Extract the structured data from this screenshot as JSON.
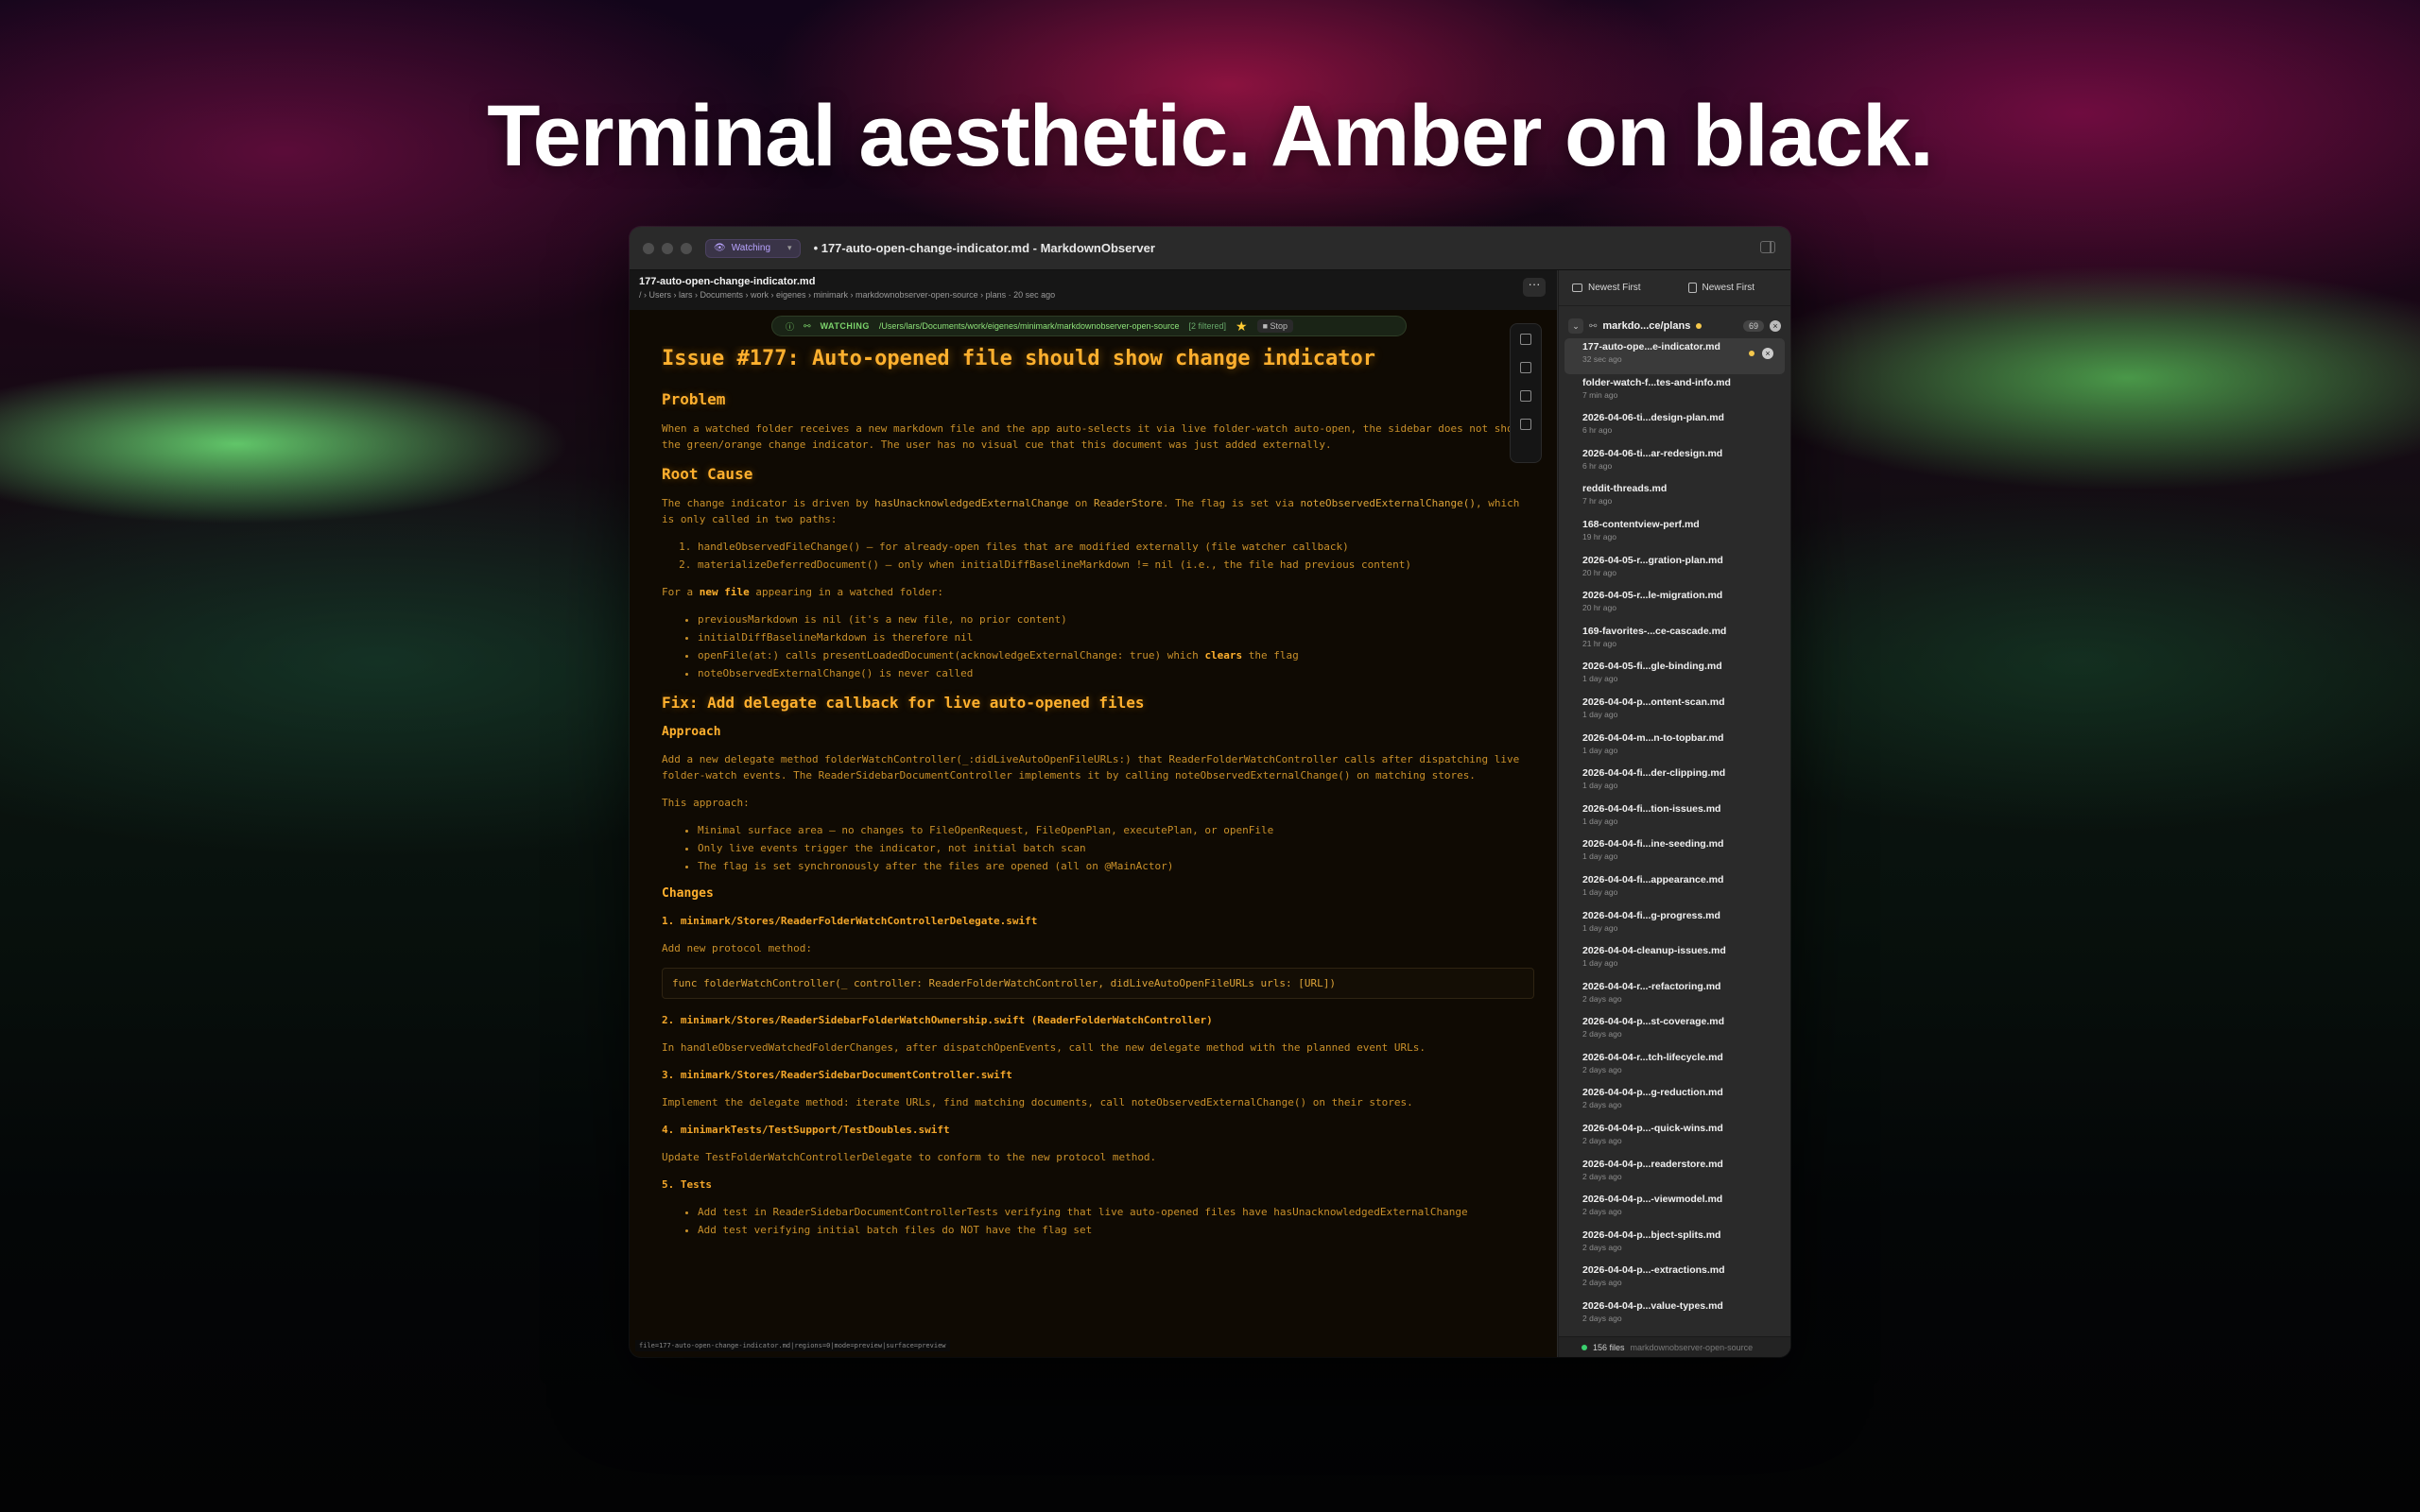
{
  "headline": "Terminal aesthetic. Amber on black.",
  "window": {
    "title": "• 177-auto-open-change-indicator.md - MarkdownObserver",
    "watch_pill": "Watching"
  },
  "doc_header": {
    "filename": "177-auto-open-change-indicator.md",
    "path": "/ › Users › lars › Documents › work › eigenes › minimark › markdownobserver-open-source › plans · 20 sec ago",
    "more": "···"
  },
  "watch_bar": {
    "label": "WATCHING",
    "path": "/Users/lars/Documents/work/eigenes/minimark/markdownobserver-open-source",
    "filtered": "[2 filtered]",
    "stop": "■ Stop"
  },
  "doc": {
    "h1": "Issue #177: Auto-opened file should show change indicator",
    "problem_h": "Problem",
    "problem_p": "When a watched folder receives a new markdown file and the app auto-selects it via live folder-watch auto-open, the sidebar does not show the green/orange change indicator. The user has no visual cue that this document was just added externally.",
    "root_h": "Root Cause",
    "root_p1a": "The change indicator is driven by ",
    "root_p1b": "hasUnacknowledgedExternalChange",
    "root_p1c": " on ",
    "root_p1d": "ReaderStore",
    "root_p1e": ". The flag is set via ",
    "root_p1f": "noteObservedExternalChange()",
    "root_p1g": ", which is only called in two paths:",
    "root_ol1": "handleObservedFileChange() — for already-open files that are modified externally (file watcher callback)",
    "root_ol2": "materializeDeferredDocument() — only when initialDiffBaselineMarkdown != nil (i.e., the file had previous content)",
    "root_p2a": "For a ",
    "root_p2b": "new file",
    "root_p2c": " appearing in a watched folder:",
    "root_ul1": "previousMarkdown is nil (it's a new file, no prior content)",
    "root_ul2": "initialDiffBaselineMarkdown is therefore nil",
    "root_ul3a": "openFile(at:) calls presentLoadedDocument(acknowledgeExternalChange: true) which ",
    "root_ul3b": "clears",
    "root_ul3c": " the flag",
    "root_ul4": "noteObservedExternalChange() is never called",
    "fix_h": "Fix: Add delegate callback for live auto-opened files",
    "approach_h": "Approach",
    "approach_p": "Add a new delegate method folderWatchController(_:didLiveAutoOpenFileURLs:) that ReaderFolderWatchController calls after dispatching live folder-watch events. The ReaderSidebarDocumentController implements it by calling noteObservedExternalChange() on matching stores.",
    "approach_p2": "This approach:",
    "approach_ul1": "Minimal surface area — no changes to FileOpenRequest, FileOpenPlan, executePlan, or openFile",
    "approach_ul2": "Only live events trigger the indicator, not initial batch scan",
    "approach_ul3": "The flag is set synchronously after the files are opened (all on @MainActor)",
    "changes_h": "Changes",
    "c1_h": "1. minimark/Stores/ReaderFolderWatchControllerDelegate.swift",
    "c1_p": "Add new protocol method:",
    "c1_code": "func folderWatchController(_ controller: ReaderFolderWatchController, didLiveAutoOpenFileURLs urls: [URL])",
    "c2_h": "2. minimark/Stores/ReaderSidebarFolderWatchOwnership.swift (ReaderFolderWatchController)",
    "c2_p": "In handleObservedWatchedFolderChanges, after dispatchOpenEvents, call the new delegate method with the planned event URLs.",
    "c3_h": "3. minimark/Stores/ReaderSidebarDocumentController.swift",
    "c3_p": "Implement the delegate method: iterate URLs, find matching documents, call noteObservedExternalChange() on their stores.",
    "c4_h": "4. minimarkTests/TestSupport/TestDoubles.swift",
    "c4_p": "Update TestFolderWatchControllerDelegate to conform to the new protocol method.",
    "c5_h": "5. Tests",
    "c5_ul1": "Add test in ReaderSidebarDocumentControllerTests verifying that live auto-opened files have hasUnacknowledgedExternalChange",
    "c5_ul2": "Add test verifying initial batch files do NOT have the flag set"
  },
  "status_strip": "file=177-auto-open-change-indicator.md|regions=0|mode=preview|surface=preview",
  "sidebar": {
    "sort_left": "Newest First",
    "sort_right": "Newest First",
    "folder_name": "markdo...ce/plans",
    "folder_count": "69",
    "files": [
      {
        "name": "177-auto-ope...e-indicator.md",
        "time": "32 sec ago"
      },
      {
        "name": "folder-watch-f...tes-and-info.md",
        "time": "7 min ago"
      },
      {
        "name": "2026-04-06-ti...design-plan.md",
        "time": "6 hr ago"
      },
      {
        "name": "2026-04-06-ti...ar-redesign.md",
        "time": "6 hr ago"
      },
      {
        "name": "reddit-threads.md",
        "time": "7 hr ago"
      },
      {
        "name": "168-contentview-perf.md",
        "time": "19 hr ago"
      },
      {
        "name": "2026-04-05-r...gration-plan.md",
        "time": "20 hr ago"
      },
      {
        "name": "2026-04-05-r...le-migration.md",
        "time": "20 hr ago"
      },
      {
        "name": "169-favorites-...ce-cascade.md",
        "time": "21 hr ago"
      },
      {
        "name": "2026-04-05-fi...gle-binding.md",
        "time": "1 day ago"
      },
      {
        "name": "2026-04-04-p...ontent-scan.md",
        "time": "1 day ago"
      },
      {
        "name": "2026-04-04-m...n-to-topbar.md",
        "time": "1 day ago"
      },
      {
        "name": "2026-04-04-fi...der-clipping.md",
        "time": "1 day ago"
      },
      {
        "name": "2026-04-04-fi...tion-issues.md",
        "time": "1 day ago"
      },
      {
        "name": "2026-04-04-fi...ine-seeding.md",
        "time": "1 day ago"
      },
      {
        "name": "2026-04-04-fi...appearance.md",
        "time": "1 day ago"
      },
      {
        "name": "2026-04-04-fi...g-progress.md",
        "time": "1 day ago"
      },
      {
        "name": "2026-04-04-cleanup-issues.md",
        "time": "1 day ago"
      },
      {
        "name": "2026-04-04-r...-refactoring.md",
        "time": "2 days ago"
      },
      {
        "name": "2026-04-04-p...st-coverage.md",
        "time": "2 days ago"
      },
      {
        "name": "2026-04-04-r...tch-lifecycle.md",
        "time": "2 days ago"
      },
      {
        "name": "2026-04-04-p...g-reduction.md",
        "time": "2 days ago"
      },
      {
        "name": "2026-04-04-p...-quick-wins.md",
        "time": "2 days ago"
      },
      {
        "name": "2026-04-04-p...readerstore.md",
        "time": "2 days ago"
      },
      {
        "name": "2026-04-04-p...-viewmodel.md",
        "time": "2 days ago"
      },
      {
        "name": "2026-04-04-p...bject-splits.md",
        "time": "2 days ago"
      },
      {
        "name": "2026-04-04-p...-extractions.md",
        "time": "2 days ago"
      },
      {
        "name": "2026-04-04-p...value-types.md",
        "time": "2 days ago"
      }
    ],
    "footer_count": "156 files",
    "footer_repo": "markdownobserver-open-source"
  }
}
